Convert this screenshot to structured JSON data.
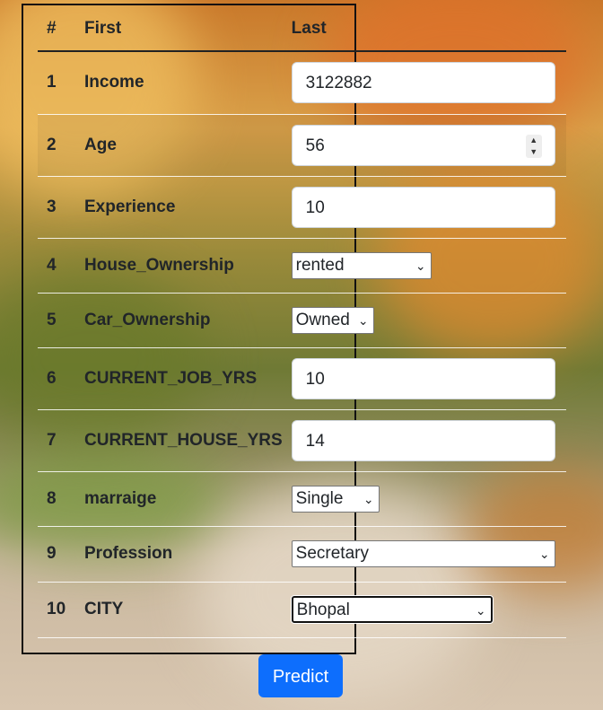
{
  "table": {
    "headers": {
      "num": "#",
      "first": "First",
      "last": "Last"
    },
    "rows": [
      {
        "num": "1",
        "label": "Income",
        "control": "text",
        "value": "3122882"
      },
      {
        "num": "2",
        "label": "Age",
        "control": "number",
        "value": "56"
      },
      {
        "num": "3",
        "label": "Experience",
        "control": "text",
        "value": "10"
      },
      {
        "num": "4",
        "label": "House_Ownership",
        "control": "select",
        "value": "rented"
      },
      {
        "num": "5",
        "label": "Car_Ownership",
        "control": "select",
        "value": "Owned"
      },
      {
        "num": "6",
        "label": "CURRENT_JOB_YRS",
        "control": "text",
        "value": "10"
      },
      {
        "num": "7",
        "label": "CURRENT_HOUSE_YRS",
        "control": "text",
        "value": "14"
      },
      {
        "num": "8",
        "label": "marraige",
        "control": "select",
        "value": "Single"
      },
      {
        "num": "9",
        "label": "Profession",
        "control": "select",
        "value": "Secretary"
      },
      {
        "num": "10",
        "label": "CITY",
        "control": "select",
        "value": "Bhopal"
      }
    ]
  },
  "predict_label": "Predict",
  "icons": {
    "caret": "chevron-down-icon",
    "spinner": "spin-arrows-icon"
  },
  "colors": {
    "primary": "#0d6efd",
    "text": "#212529",
    "input_border": "#ced4da"
  }
}
